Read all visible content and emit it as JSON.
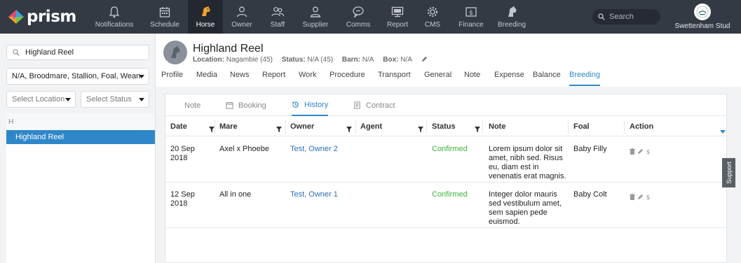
{
  "brand": {
    "name": "prism"
  },
  "nav": {
    "items": [
      {
        "label": "Notifications",
        "icon": "bell-icon"
      },
      {
        "label": "Schedule",
        "icon": "calendar-icon"
      },
      {
        "label": "Horse",
        "icon": "horse-head-icon",
        "active": true
      },
      {
        "label": "Owner",
        "icon": "person-icon"
      },
      {
        "label": "Staff",
        "icon": "people-icon"
      },
      {
        "label": "Supplier",
        "icon": "person-tie-icon"
      },
      {
        "label": "Comms",
        "icon": "chat-bubble-icon"
      },
      {
        "label": "Report",
        "icon": "monitor-icon"
      },
      {
        "label": "CMS",
        "icon": "gear-icon"
      },
      {
        "label": "Finance",
        "icon": "dollar-icon"
      },
      {
        "label": "Breeding",
        "icon": "horse-icon"
      }
    ]
  },
  "search": {
    "placeholder": "Search"
  },
  "stud": {
    "name": "Swettenham Stud"
  },
  "sidebar": {
    "search_value": "Highland Reel",
    "type_filter": "N/A, Broodmare, Stallion, Foal, Weanling",
    "location_placeholder": "Select Location",
    "status_placeholder": "Select Status",
    "group_letter": "H",
    "items": [
      "Highland Reel"
    ]
  },
  "horse": {
    "name": "Highland Reel",
    "location_label": "Location:",
    "location_value": "Nagambie (45)",
    "status_label": "Status:",
    "status_value": "N/A (45)",
    "barn_label": "Barn:",
    "barn_value": "N/A",
    "box_label": "Box:",
    "box_value": "N/A"
  },
  "tabs": [
    "Profile",
    "Media",
    "News",
    "Report",
    "Work",
    "Procedure",
    "Transport",
    "General",
    "Note",
    "Expense",
    "Balance",
    "Breeding"
  ],
  "active_tab": "Breeding",
  "subtabs": [
    {
      "label": "Note",
      "icon": ""
    },
    {
      "label": "Booking",
      "icon": "calendar-icon"
    },
    {
      "label": "History",
      "icon": "history-icon"
    },
    {
      "label": "Contract",
      "icon": "document-icon"
    }
  ],
  "active_subtab": "History",
  "table": {
    "columns": [
      "Date",
      "Mare",
      "Owner",
      "Agent",
      "Status",
      "Note",
      "Foal",
      "Action"
    ],
    "rows": [
      {
        "date_line1": "20 Sep",
        "date_line2": "2018",
        "mare": "Axel x Phoebe",
        "owner": "Test, Owner 2",
        "agent": "",
        "status": "Confirmed",
        "note": [
          "Lorem ipsum dolor sit",
          "amet, nibh sed. Risus",
          "eu, diam est in",
          "venenatis erat magnis."
        ],
        "foal": "Baby Filly"
      },
      {
        "date_line1": "12 Sep",
        "date_line2": "2018",
        "mare": "All in one",
        "owner": "Test, Owner 1",
        "agent": "",
        "status": "Confirmed",
        "note": [
          "Integer dolor mauris",
          "sed vestibulum amet,",
          "sem sapien pede",
          "euismod."
        ],
        "foal": "Baby Colt"
      }
    ]
  },
  "support_label": "Support",
  "colors": {
    "accent": "#2f87c9",
    "topbar": "#343a44",
    "confirmed": "#3cb43c",
    "link": "#2f6fb6"
  }
}
